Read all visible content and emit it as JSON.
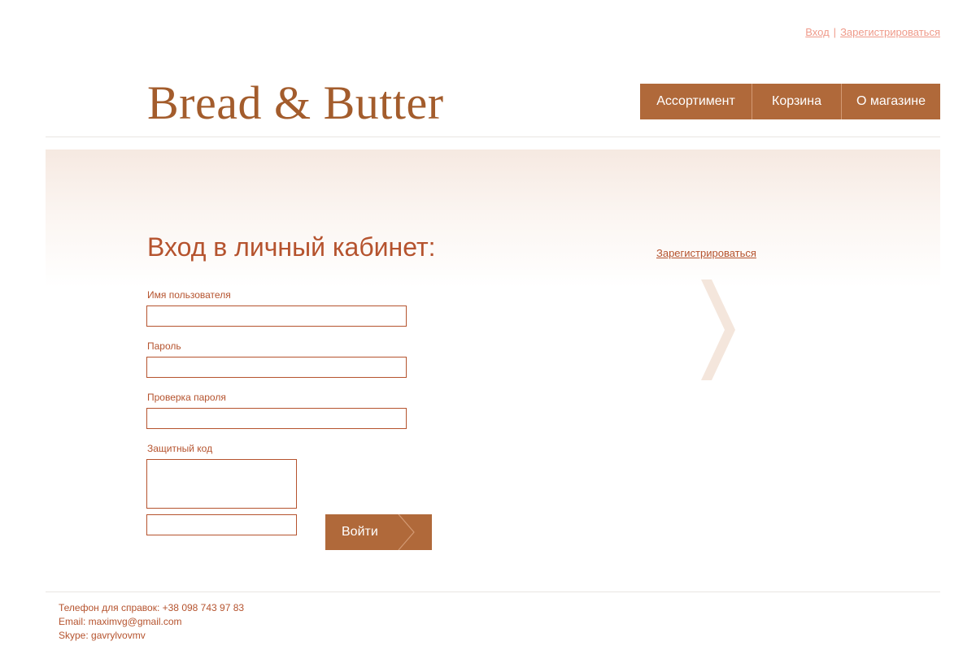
{
  "header": {
    "login_link": "Вход",
    "separator": "|",
    "register_link": "Зарегистрироваться",
    "logo": "Bread & Butter",
    "nav": [
      {
        "label": "Ассортимент"
      },
      {
        "label": "Корзина"
      },
      {
        "label": "О магазине"
      }
    ]
  },
  "main": {
    "title": "Вход в личный кабинет:",
    "register_link": "Зарегистрироваться",
    "form": {
      "username_label": "Имя пользователя",
      "username_value": "",
      "password_label": "Пароль",
      "password_value": "",
      "password_confirm_label": "Проверка пароля",
      "password_confirm_value": "",
      "captcha_label": "Защитный код",
      "captcha_value": "",
      "submit_label": "Войти"
    }
  },
  "footer": {
    "phone": "Телефон для справок: +38 098 743 97 83",
    "email": "Email: maximvg@gmail.com",
    "skype": "Skype: gavrylvovmv"
  },
  "colors": {
    "brand": "#b0693a",
    "text_accent": "#b5532e",
    "top_link": "#ef9a8a",
    "banner_gradient_top": "#f6e9e1",
    "chevron": "#f4e6dc"
  },
  "icons": {
    "big_chevron": "chevron-right-icon",
    "button_chevron": "chevron-right-icon"
  }
}
